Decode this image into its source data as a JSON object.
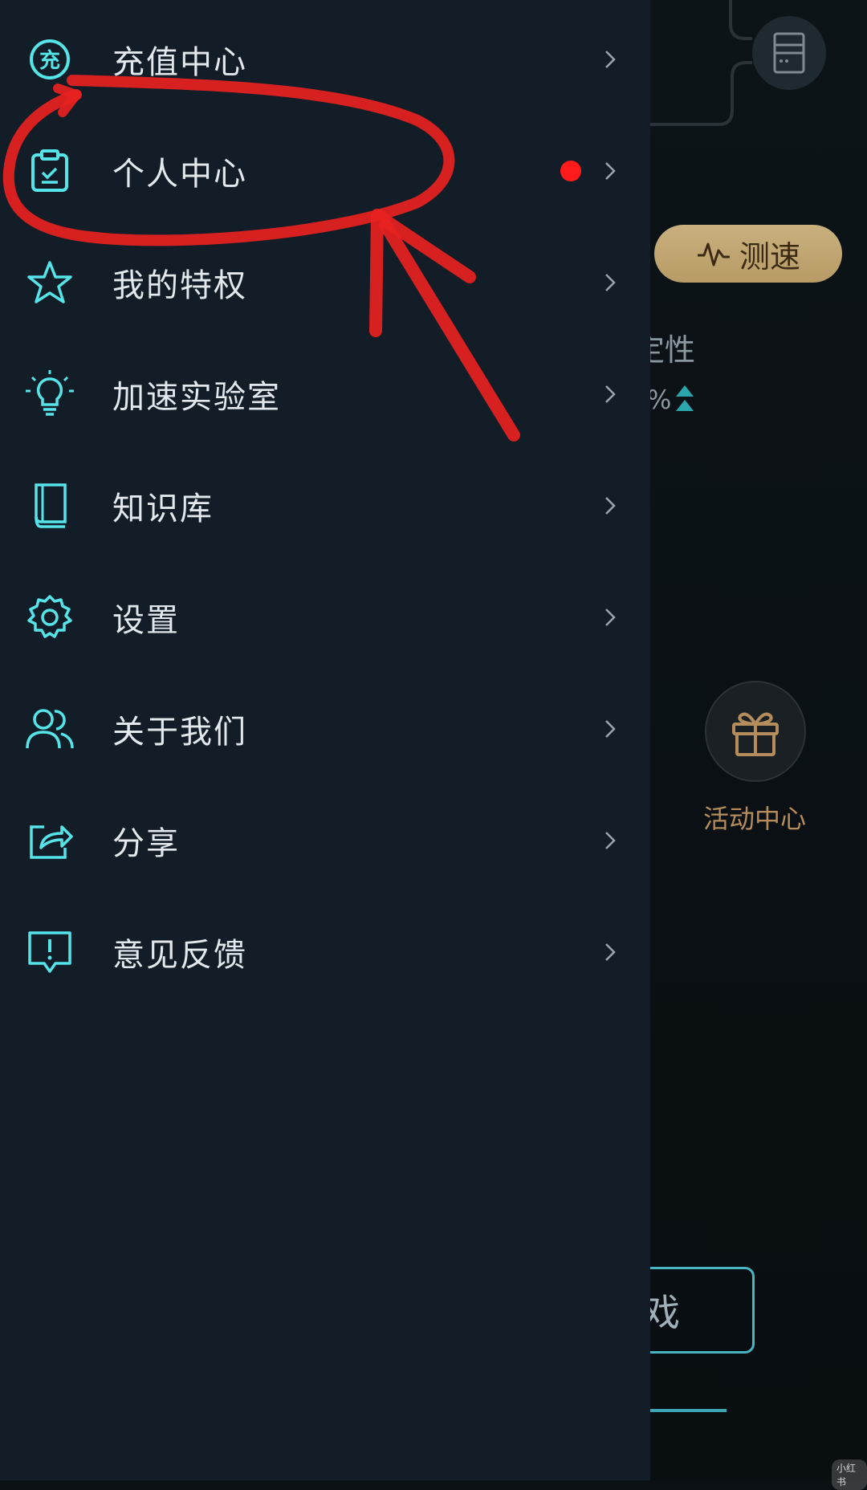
{
  "drawer": {
    "items": [
      {
        "label": "充值中心",
        "icon": "recharge-icon"
      },
      {
        "label": "个人中心",
        "icon": "clipboard-check-icon",
        "badge": true
      },
      {
        "label": "我的特权",
        "icon": "star-icon"
      },
      {
        "label": "加速实验室",
        "icon": "lightbulb-icon"
      },
      {
        "label": "知识库",
        "icon": "book-icon"
      },
      {
        "label": "设置",
        "icon": "gear-icon"
      },
      {
        "label": "关于我们",
        "icon": "users-icon"
      },
      {
        "label": "分享",
        "icon": "share-icon"
      },
      {
        "label": "意见反馈",
        "icon": "feedback-icon"
      }
    ]
  },
  "background": {
    "speed_test_label": "测速",
    "stability_fragment": "定性",
    "percent_fragment": "%",
    "activity_center_label": "活动中心",
    "game_button_fragment": "戏",
    "watermark": "小红书"
  },
  "colors": {
    "drawer_bg": "#131d27",
    "icon_teal": "#55e4e8",
    "badge_red": "#ff1b1b",
    "speed_button_gold": "#c8b07e",
    "annotation_red": "#e8221f"
  }
}
